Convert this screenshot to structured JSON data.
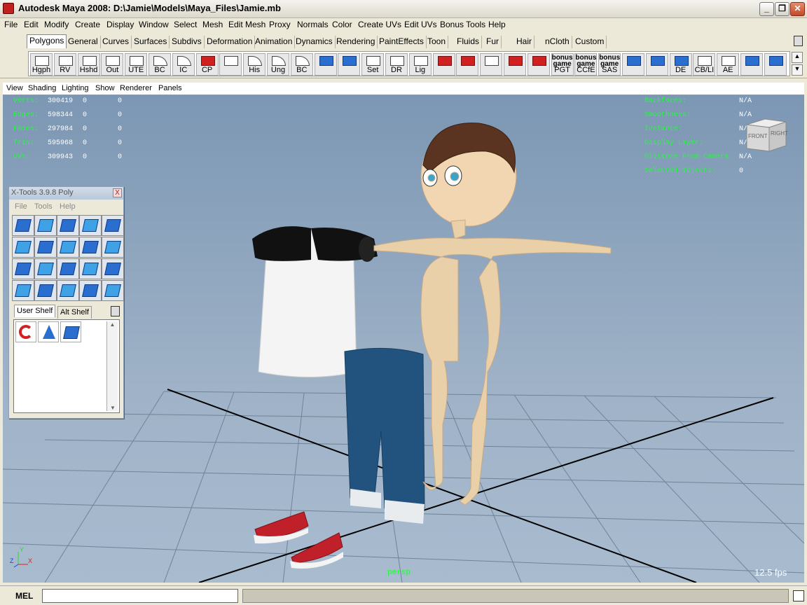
{
  "window": {
    "title": "Autodesk Maya 2008: D:\\Jamie\\Models\\Maya_Files\\Jamie.mb",
    "min_icon": "minimize-icon",
    "max_icon": "maximize-icon",
    "close_icon": "close-icon",
    "min_glyph": "_",
    "max_glyph": "❐",
    "close_glyph": "✕"
  },
  "menubar": [
    "File",
    "Edit",
    "Modify",
    "Create",
    "Display",
    "Window",
    "Select",
    "Mesh",
    "Edit Mesh",
    "Proxy",
    "Normals",
    "Color",
    "Create UVs",
    "Edit UVs",
    "Bonus Tools",
    "Help"
  ],
  "shelf_tabs": [
    "Polygons",
    "General",
    "Curves",
    "Surfaces",
    "Subdivs",
    "Deformation",
    "Animation",
    "Dynamics",
    "Rendering",
    "PaintEffects",
    "Toon",
    "Fluids",
    "Fur",
    "Hair",
    "nCloth",
    "Custom"
  ],
  "active_shelf_tab": "Polygons",
  "shelf_icons": [
    {
      "label": "Hgph",
      "icon": "hypergraph-icon"
    },
    {
      "label": "RV",
      "icon": "render-view-icon"
    },
    {
      "label": "Hshd",
      "icon": "hypershade-icon"
    },
    {
      "label": "Out",
      "icon": "outliner-icon"
    },
    {
      "label": "UTE",
      "icon": "uv-texture-editor-icon"
    },
    {
      "label": "BC",
      "icon": "bezier-curve-icon"
    },
    {
      "label": "IC",
      "icon": "isoparm-curve-icon"
    },
    {
      "label": "CP",
      "icon": "create-polygon-icon"
    },
    {
      "label": "",
      "icon": "wire-cube-icon"
    },
    {
      "label": "His",
      "icon": "history-icon"
    },
    {
      "label": "Ung",
      "icon": "ungroup-icon"
    },
    {
      "label": "BC",
      "icon": "bevel-curve-icon"
    },
    {
      "label": "",
      "icon": "poly-cube-icon"
    },
    {
      "label": "",
      "icon": "sphere-icon"
    },
    {
      "label": "Set",
      "icon": "set-key-icon"
    },
    {
      "label": "DR",
      "icon": "delete-icon"
    },
    {
      "label": "Lig",
      "icon": "light-icon"
    },
    {
      "label": "",
      "icon": "rotate-icon"
    },
    {
      "label": "",
      "icon": "joint-icon"
    },
    {
      "label": "",
      "icon": "camera-icon"
    },
    {
      "label": "",
      "icon": "axis-icon"
    },
    {
      "label": "",
      "icon": "curve-tool-icon"
    },
    {
      "label": "PGT",
      "icon": "bonus-game-pgt-icon",
      "top": "bonus game"
    },
    {
      "label": "CCfE",
      "icon": "bonus-game-ccfe-icon",
      "top": "bonus game"
    },
    {
      "label": "SAS",
      "icon": "bonus-game-sas-icon",
      "top": "bonus game"
    },
    {
      "label": "",
      "icon": "extrude-face-icon"
    },
    {
      "label": "",
      "icon": "split-poly-icon"
    },
    {
      "label": "DE",
      "icon": "delete-edge-icon"
    },
    {
      "label": "CB/LI",
      "icon": "combine-icon"
    },
    {
      "label": "AE",
      "icon": "attribute-editor-icon"
    },
    {
      "label": "",
      "icon": "poly-cylinder-icon"
    },
    {
      "label": "",
      "icon": "cv-curve-icon"
    }
  ],
  "panel_menu": [
    "View",
    "Shading",
    "Lighting",
    "Show",
    "Renderer",
    "Panels"
  ],
  "hud_left": [
    {
      "label": "Verts:",
      "v1": "300419",
      "v2": "0",
      "v3": "0"
    },
    {
      "label": "Edges:",
      "v1": "598344",
      "v2": "0",
      "v3": "0"
    },
    {
      "label": "Faces:",
      "v1": "297984",
      "v2": "0",
      "v3": "0"
    },
    {
      "label": "Tris:",
      "v1": "595968",
      "v2": "0",
      "v3": "0"
    },
    {
      "label": "UVs:",
      "v1": "309943",
      "v2": "0",
      "v3": "0"
    }
  ],
  "hud_right": [
    {
      "label": "Backfaces:",
      "value": "N/A"
    },
    {
      "label": "Smoothness:",
      "value": "N/A"
    },
    {
      "label": "Instance:",
      "value": "N/A"
    },
    {
      "label": "Display Layer:",
      "value": "N/A"
    },
    {
      "label": "Distance From Camera:",
      "value": "N/A"
    },
    {
      "label": "Selected Objects:",
      "value": "0"
    }
  ],
  "viewcube": {
    "front": "FRONT",
    "right": "RIGHT"
  },
  "camera_name": "persp",
  "fps": "12.5 fps",
  "axis": {
    "y": "Y",
    "z": "Z",
    "x": "X"
  },
  "xtools": {
    "title": "X-Tools 3.9.8 Poly",
    "close": "X",
    "menus": [
      "File",
      "Tools",
      "Help"
    ],
    "tabs": [
      "User Shelf",
      "Alt Shelf"
    ],
    "active_tab": "User Shelf",
    "trash_icon": "trash-icon"
  },
  "bottom": {
    "mel_label": "MEL",
    "mel_value": ""
  },
  "colors": {
    "viewport_top": "#7c97b4",
    "viewport_bottom": "#a9bbcf",
    "hud_green": "#1aff33",
    "accent": "#2a6fd0"
  }
}
